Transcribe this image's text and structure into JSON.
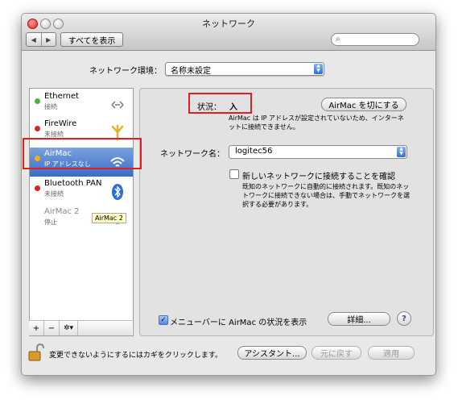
{
  "window": {
    "title": "ネットワーク",
    "show_all": "すべてを表示",
    "search_placeholder": ""
  },
  "location": {
    "label": "ネットワーク環境：",
    "value": "名称未設定"
  },
  "services": [
    {
      "name": "Ethernet",
      "status": "接続",
      "dot_color": "#3dbb2b",
      "icon": "ethernet-icon"
    },
    {
      "name": "FireWire",
      "status": "未接続",
      "dot_color": "#d8261e",
      "icon": "firewire-icon"
    },
    {
      "name": "AirMac",
      "status": "IP アドレスなし",
      "dot_color": "#f0b400",
      "icon": "wifi-icon"
    },
    {
      "name": "Bluetooth PAN",
      "status": "未接続",
      "dot_color": "#d8261e",
      "icon": "bluetooth-icon"
    },
    {
      "name": "AirMac 2",
      "status": "停止",
      "dot_color": "",
      "icon": "wifi-icon"
    }
  ],
  "tooltip": "AirMac 2",
  "sidebar_tools": {
    "add": "+",
    "remove": "−",
    "action": "✲▾"
  },
  "detail": {
    "status_label": "状況：",
    "status_value": "入",
    "airmac_off_button": "AirMac を切にする",
    "status_description": "AirMac は IP アドレスが設定されていないため、インターネットに接続できません。",
    "network_name_label": "ネットワーク名：",
    "network_name_value": "logitec56",
    "ask_label": "新しいネットワークに接続することを確認",
    "ask_description": "既知のネットワークに自動的に接続されます。既知のネットワークに接続できない場合は、手動でネットワークを選択する必要があります。",
    "menubar_label": "メニューバーに AirMac の状況を表示",
    "details_button": "詳細...",
    "help_button": "?"
  },
  "footer": {
    "lock_text": "変更できないようにするにはカギをクリックします。",
    "assistant_button": "アシスタント...",
    "revert_button": "元に戻す",
    "apply_button": "適用"
  },
  "colors": {
    "highlight": "#e0201a",
    "selection": "#3a6cc8"
  }
}
